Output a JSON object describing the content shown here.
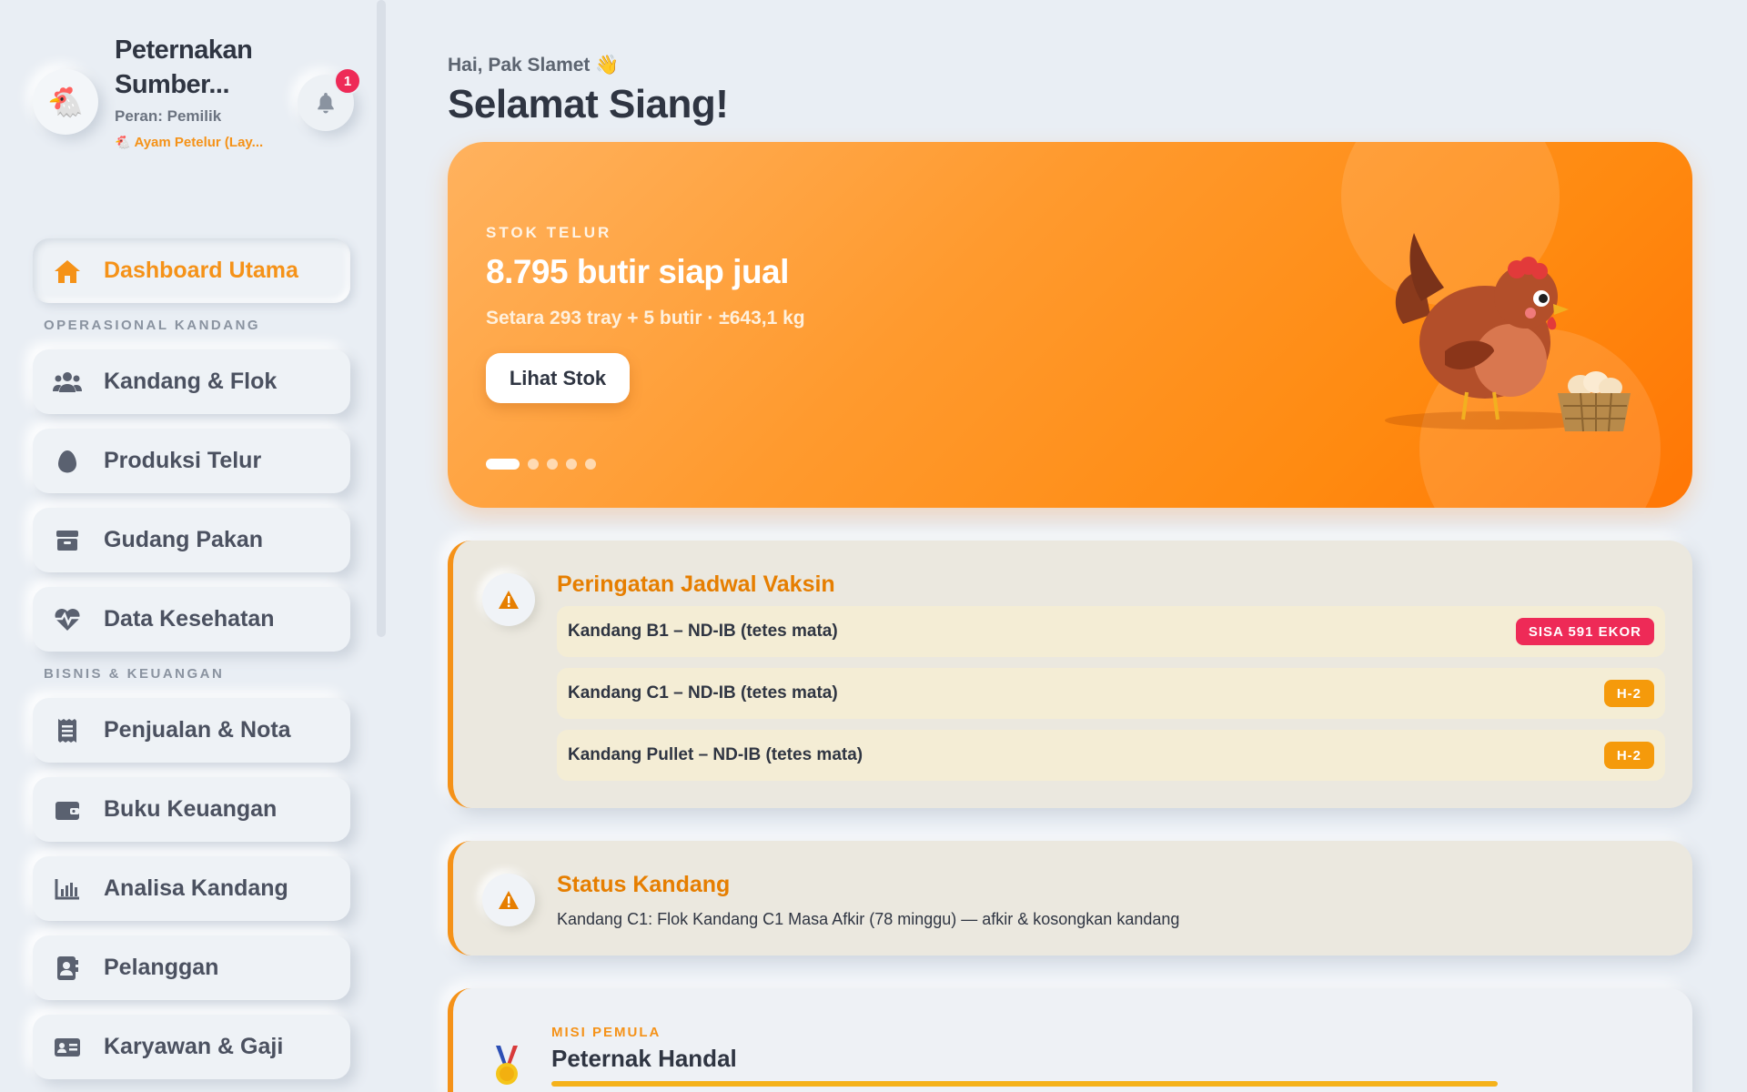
{
  "sidebar": {
    "farm_name_line1": "Peternakan",
    "farm_name_line2": "Sumber...",
    "role": "Peran: Pemilik",
    "species": "Ayam Petelur (Lay...",
    "notification_count": "1",
    "nav": {
      "dashboard": "Dashboard Utama",
      "section_ops": "OPERASIONAL KANDANG",
      "kandang": "Kandang & Flok",
      "produksi": "Produksi Telur",
      "gudang": "Gudang Pakan",
      "kesehatan": "Data Kesehatan",
      "section_biz": "BISNIS & KEUANGAN",
      "penjualan": "Penjualan & Nota",
      "keuangan": "Buku Keuangan",
      "analisa": "Analisa Kandang",
      "pelanggan": "Pelanggan",
      "karyawan": "Karyawan & Gaji"
    },
    "icons": [
      "home-icon",
      "users-icon",
      "egg-icon",
      "box-icon",
      "heartbeat-icon",
      "receipt-icon",
      "wallet-icon",
      "bar-chart-icon",
      "contact-book-icon",
      "id-card-icon"
    ]
  },
  "header": {
    "greeting": "Hai, Pak Slamet 👋",
    "title": "Selamat Siang!"
  },
  "hero": {
    "label": "STOK TELUR",
    "value": "8.795 butir siap jual",
    "subtitle": "Setara 293 tray + 5 butir · ±643,1 kg",
    "button": "Lihat Stok",
    "active_slide": 1,
    "slide_count": 5
  },
  "vaksin": {
    "title": "Peringatan Jadwal Vaksin",
    "rows": [
      {
        "text": "Kandang B1 – ND-IB (tetes mata)",
        "badge": "SISA 591 EKOR"
      },
      {
        "text": "Kandang C1 – ND-IB (tetes mata)",
        "badge": "H-2"
      },
      {
        "text": "Kandang Pullet – ND-IB (tetes mata)",
        "badge": "H-2"
      }
    ]
  },
  "status": {
    "title": "Status Kandang",
    "text": "Kandang C1: Flok Kandang C1 Masa Afkir (78 minggu) — afkir & kosongkan kandang"
  },
  "misi": {
    "label": "MISI PEMULA",
    "title": "Peternak Handal"
  },
  "colors": {
    "accent": "#f59218",
    "danger": "#ee2a57",
    "background": "#e9eef4"
  }
}
